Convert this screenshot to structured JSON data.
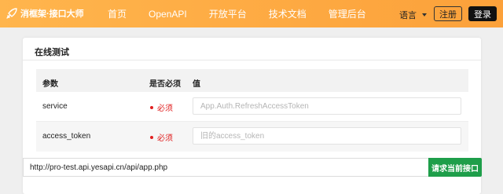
{
  "header": {
    "brand": "消框架·接口大师",
    "nav": [
      "首页",
      "OpenAPI",
      "开放平台",
      "技术文档",
      "管理后台"
    ],
    "language": "语言",
    "register_label": "注册",
    "login_label": "登录",
    "colors": {
      "bar": "#fca13a",
      "login_bg": "#111111"
    }
  },
  "panel": {
    "title": "在线测试",
    "columns": {
      "param": "参数",
      "required": "是否必须",
      "value": "值"
    },
    "rows": [
      {
        "param": "service",
        "required": "必须",
        "value": "",
        "placeholder": "App.Auth.RefreshAccessToken"
      },
      {
        "param": "access_token",
        "required": "必须",
        "value": "",
        "placeholder": "旧的access_token"
      }
    ]
  },
  "request": {
    "url": "http://pro-test.api.yesapi.cn/api/app.php",
    "submit_label": "请求当前接口",
    "color": "#1e9e4a"
  },
  "icons": {
    "logo": "rocket-icon",
    "dropdown": "caret-down-icon",
    "required": "dot-icon"
  }
}
